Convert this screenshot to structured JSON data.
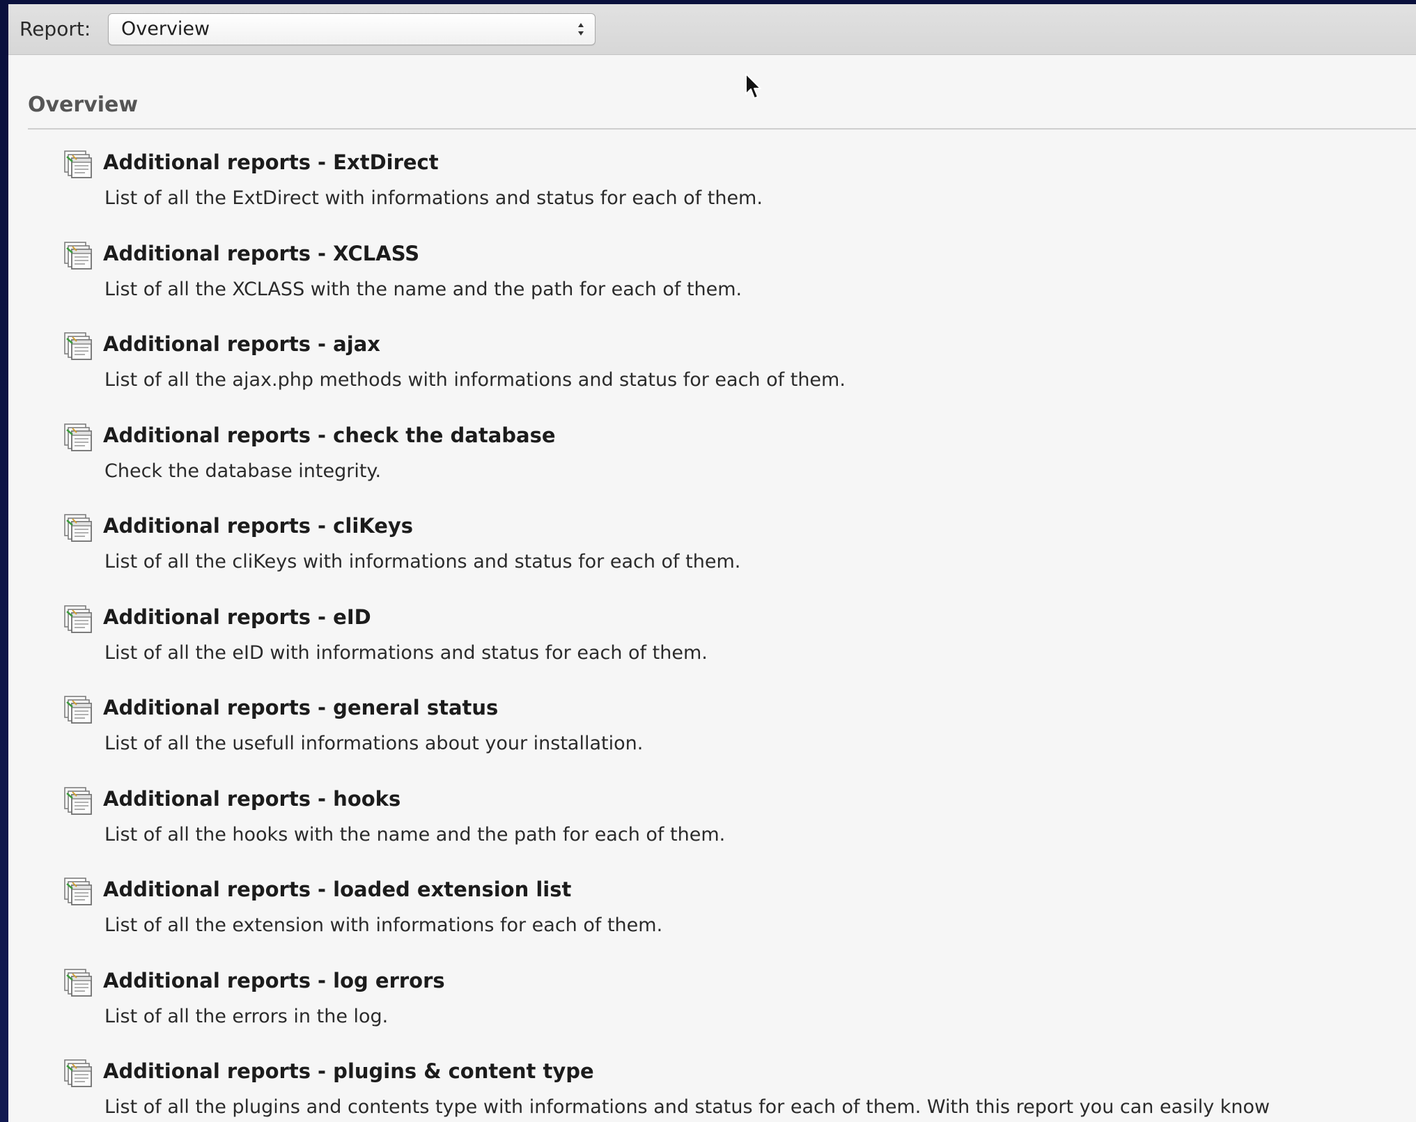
{
  "toolbar": {
    "label": "Report:",
    "select_value": "Overview"
  },
  "section": {
    "title": "Overview"
  },
  "icon_name": "report-icon",
  "reports": [
    {
      "title": "Additional reports - ExtDirect",
      "description": "List of all the ExtDirect with informations and status for each of them."
    },
    {
      "title": "Additional reports - XCLASS",
      "description": "List of all the XCLASS with the name and the path for each of them."
    },
    {
      "title": "Additional reports - ajax",
      "description": "List of all the ajax.php methods with informations and status for each of them."
    },
    {
      "title": "Additional reports - check the database",
      "description": "Check the database integrity."
    },
    {
      "title": "Additional reports - cliKeys",
      "description": "List of all the cliKeys with informations and status for each of them."
    },
    {
      "title": "Additional reports - eID",
      "description": "List of all the eID with informations and status for each of them."
    },
    {
      "title": "Additional reports - general status",
      "description": "List of all the usefull informations about your installation."
    },
    {
      "title": "Additional reports - hooks",
      "description": "List of all the hooks with the name and the path for each of them."
    },
    {
      "title": "Additional reports - loaded extension list",
      "description": "List of all the extension with informations for each of them."
    },
    {
      "title": "Additional reports - log errors",
      "description": "List of all the errors in the log."
    },
    {
      "title": "Additional reports - plugins & content type",
      "description": "List of all the plugins and contents type with informations and status for each of them. With this report you can easily know"
    }
  ]
}
